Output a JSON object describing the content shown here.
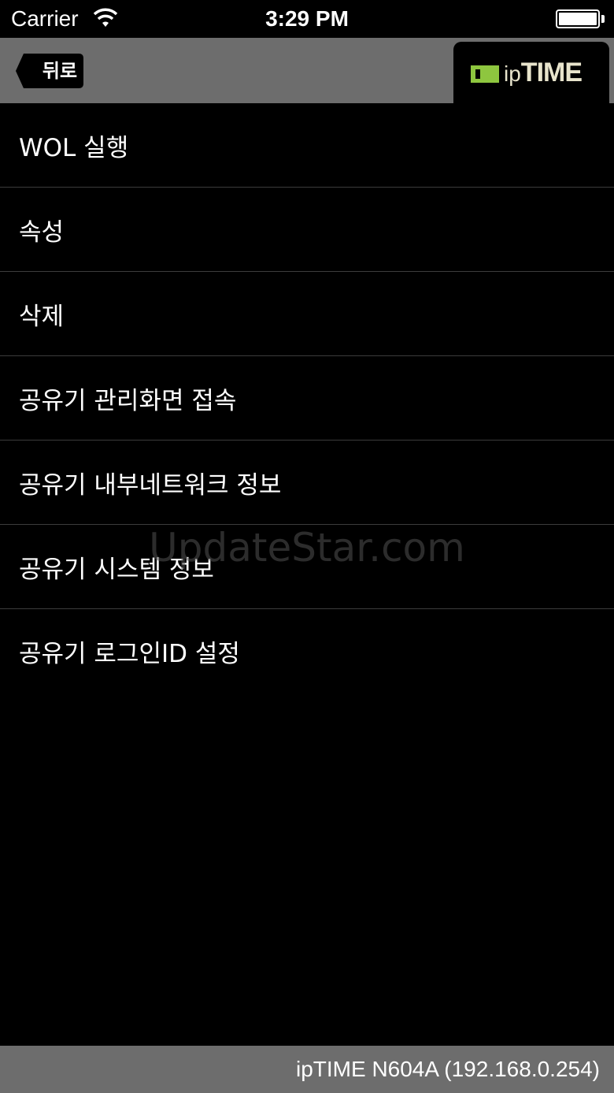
{
  "status_bar": {
    "carrier": "Carrier",
    "time": "3:29 PM"
  },
  "nav": {
    "back_label": "뒤로",
    "logo": {
      "prefix": "ip",
      "name": "TIME",
      "mark_color": "#8ec63f"
    }
  },
  "menu": {
    "items": [
      {
        "label": "WOL 실행"
      },
      {
        "label": "속성"
      },
      {
        "label": "삭제"
      },
      {
        "label": "공유기 관리화면 접속"
      },
      {
        "label": "공유기 내부네트워크 정보"
      },
      {
        "label": "공유기 시스템 정보"
      },
      {
        "label": "공유기 로그인ID 설정"
      }
    ]
  },
  "watermark": "UpdateStar.com",
  "footer": {
    "device": "ipTIME N604A (192.168.0.254)"
  },
  "colors": {
    "background": "#000000",
    "bar": "#6d6d6d",
    "divider": "#3c3c3c"
  }
}
